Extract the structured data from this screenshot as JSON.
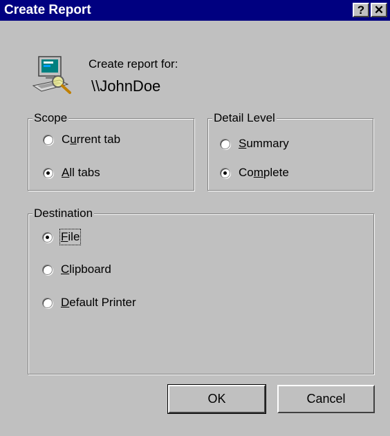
{
  "window": {
    "title": "Create Report",
    "help_glyph": "?",
    "close_glyph": "✕"
  },
  "header": {
    "label": "Create report for:",
    "target": "\\\\JohnDoe",
    "icon": "computer-search-icon"
  },
  "scope": {
    "legend": "Scope",
    "options": [
      {
        "pre": "C",
        "mnemonic": "u",
        "post": "rrent tab",
        "selected": false
      },
      {
        "pre": "",
        "mnemonic": "A",
        "post": "ll tabs",
        "selected": true
      }
    ]
  },
  "detail": {
    "legend": "Detail Level",
    "options": [
      {
        "pre": "",
        "mnemonic": "S",
        "post": "ummary",
        "selected": false
      },
      {
        "pre": "Co",
        "mnemonic": "m",
        "post": "plete",
        "selected": true
      }
    ]
  },
  "destination": {
    "legend": "Destination",
    "options": [
      {
        "pre": "",
        "mnemonic": "F",
        "post": "ile",
        "selected": true
      },
      {
        "pre": "",
        "mnemonic": "C",
        "post": "lipboard",
        "selected": false
      },
      {
        "pre": "",
        "mnemonic": "D",
        "post": "efault Printer",
        "selected": false
      }
    ]
  },
  "buttons": {
    "ok": "OK",
    "cancel": "Cancel"
  },
  "colors": {
    "face": "#c0c0c0",
    "titlebar": "#000080"
  }
}
